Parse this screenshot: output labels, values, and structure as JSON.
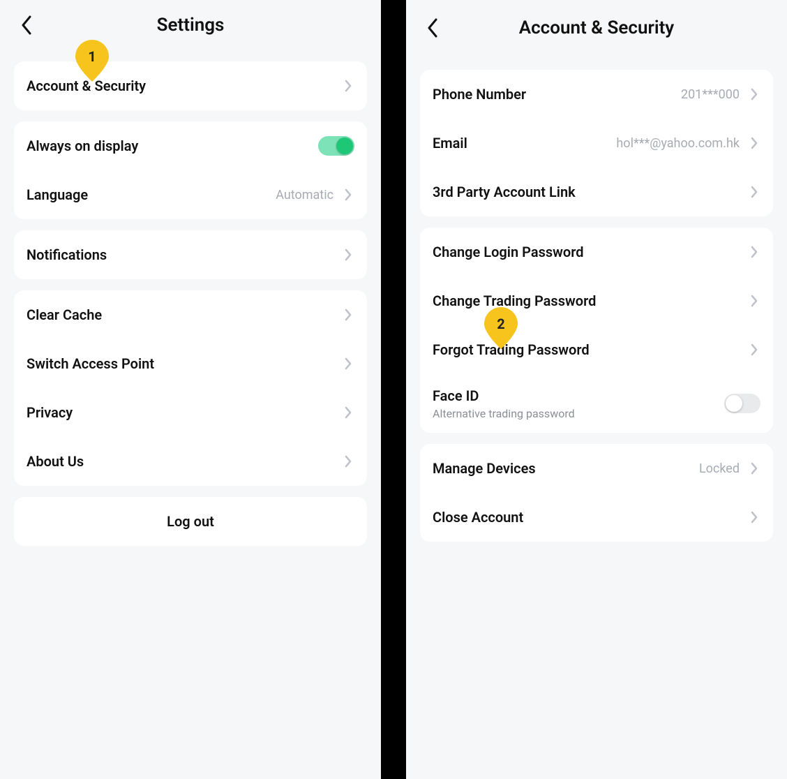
{
  "markers": {
    "m1": "1",
    "m2": "2"
  },
  "left": {
    "title": "Settings",
    "sections": [
      {
        "rows": [
          {
            "label": "Account & Security"
          }
        ]
      },
      {
        "rows": [
          {
            "label": "Always on display"
          },
          {
            "label": "Language",
            "value": "Automatic"
          }
        ]
      },
      {
        "rows": [
          {
            "label": "Notifications"
          }
        ]
      },
      {
        "rows": [
          {
            "label": "Clear Cache"
          },
          {
            "label": "Switch Access Point"
          },
          {
            "label": "Privacy"
          },
          {
            "label": "About Us"
          }
        ]
      }
    ],
    "logout": "Log out"
  },
  "right": {
    "title": "Account & Security",
    "sections": [
      {
        "rows": [
          {
            "label": "Phone Number",
            "value": "201***000"
          },
          {
            "label": "Email",
            "value": "hol***@yahoo.com.hk"
          },
          {
            "label": "3rd Party Account Link"
          }
        ]
      },
      {
        "rows": [
          {
            "label": "Change Login Password"
          },
          {
            "label": "Change Trading Password"
          },
          {
            "label": "Forgot Trading Password"
          },
          {
            "label": "Face ID",
            "sub": "Alternative trading password"
          }
        ]
      },
      {
        "rows": [
          {
            "label": "Manage Devices",
            "value": "Locked"
          },
          {
            "label": "Close Account"
          }
        ]
      }
    ]
  }
}
